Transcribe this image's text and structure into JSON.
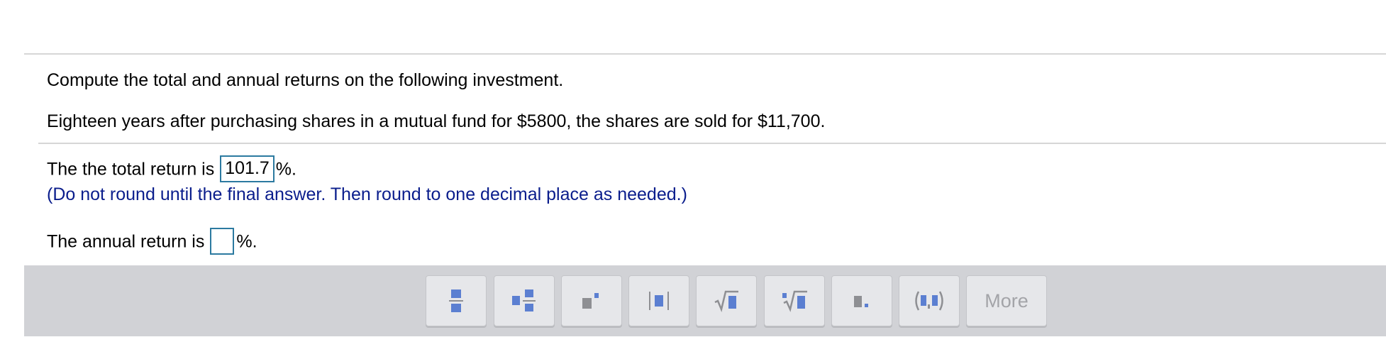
{
  "question": {
    "instruction": "Compute the total and annual returns on the following investment.",
    "problem": "Eighteen years after purchasing shares in a mutual fund for $5800, the shares are sold for $11,700."
  },
  "answers": {
    "total_prefix": "The the total return is",
    "total_value": "101.7",
    "total_suffix": "%.",
    "hint": "(Do not round until the final answer. Then round to one decimal place as needed.)",
    "annual_prefix": "The annual return is",
    "annual_value": "",
    "annual_suffix": "%."
  },
  "toolbar": {
    "buttons": [
      {
        "icon": "fraction-icon"
      },
      {
        "icon": "mixed-number-icon"
      },
      {
        "icon": "exponent-icon"
      },
      {
        "icon": "absolute-value-icon"
      },
      {
        "icon": "square-root-icon"
      },
      {
        "icon": "nth-root-icon"
      },
      {
        "icon": "decimal-icon"
      },
      {
        "icon": "ordered-pair-icon"
      }
    ],
    "more_label": "More"
  },
  "colors": {
    "hint_text": "#0a1d8c",
    "input_border": "#2c7aa0",
    "toolbar_bg": "#d1d2d6",
    "icon_blue": "#5b7fd1",
    "icon_gray": "#8e8f93"
  }
}
